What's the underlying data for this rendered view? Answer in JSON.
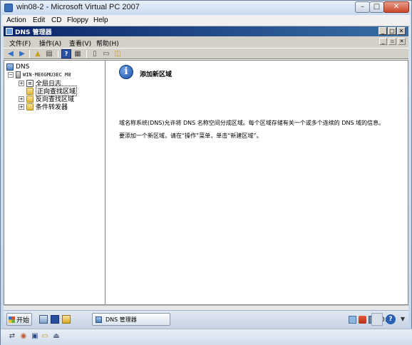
{
  "vpc": {
    "title": "win08-2 - Microsoft Virtual PC 2007",
    "menu": [
      "Action",
      "Edit",
      "CD",
      "Floppy",
      "Help"
    ]
  },
  "mmc": {
    "title": "DNS 管理器",
    "menu": [
      "文件(F)",
      "操作(A)",
      "查看(V)",
      "帮助(H)"
    ]
  },
  "tree": {
    "root": "DNS",
    "server": "WIN-ME6GMU3EC M8",
    "children": [
      {
        "label": "全局日志",
        "icon": "log-icon",
        "selected": false
      },
      {
        "label": "正向查找区域",
        "icon": "folder-icon",
        "selected": true
      },
      {
        "label": "反向查找区域",
        "icon": "folder-icon",
        "selected": false
      },
      {
        "label": "条件转发器",
        "icon": "folder-icon",
        "selected": false
      }
    ]
  },
  "info": {
    "icon": "i",
    "title": "添加新区域",
    "line1": "域名称系统(DNS)允许将 DNS 名称空间分成区域。每个区域存储有关一个或多个连续的 DNS 域的信息。",
    "line2": "要添加一个新区域，请在“操作”菜单，单击“新建区域”。"
  },
  "taskbar": {
    "start": "开始",
    "task": "DNS 管理器",
    "clock": "0:36"
  }
}
